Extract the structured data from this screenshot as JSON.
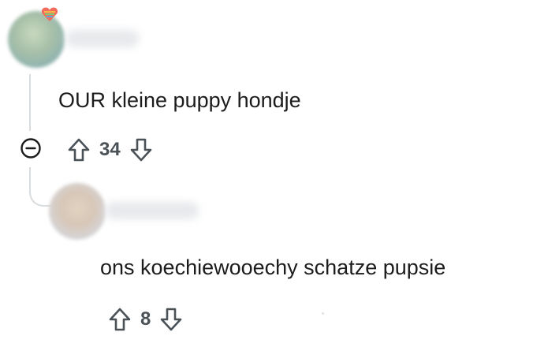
{
  "comments": [
    {
      "text": "OUR kleine puppy hondje",
      "score": "34",
      "avatar_icon": "blurred-avatar",
      "badge_icon": "rainbow-heart-icon"
    },
    {
      "text": "ons koechiewooechy schatze pupsie",
      "score": "8",
      "avatar_icon": "blurred-avatar"
    }
  ],
  "colors": {
    "text": "#1c1c1c",
    "vote_count": "#4a5257",
    "thread_line": "#d8dcdf"
  }
}
